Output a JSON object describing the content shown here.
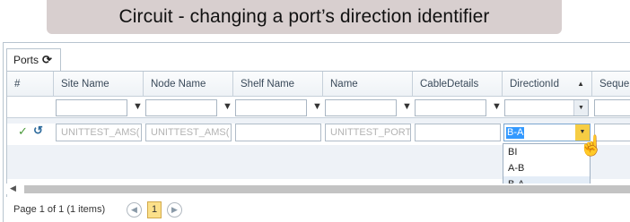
{
  "caption": "Circuit - changing a port’s direction identifier",
  "tab": {
    "label": "Ports",
    "refresh_icon": "refresh-icon"
  },
  "columns": [
    {
      "label": "#"
    },
    {
      "label": "Site Name"
    },
    {
      "label": "Node Name"
    },
    {
      "label": "Shelf Name"
    },
    {
      "label": "Name"
    },
    {
      "label": "CableDetails"
    },
    {
      "label": "DirectionId",
      "sort": "ascending"
    },
    {
      "label": "Sequen"
    }
  ],
  "row": {
    "icons": [
      "check-icon",
      "undo-icon"
    ],
    "site_name": "UNITTEST_AMS(",
    "node_name": "UNITTEST_AMS(",
    "shelf_name": "",
    "name": "UNITTEST_PORT",
    "cable_details": "",
    "direction_id": "B-A"
  },
  "dropdown": {
    "options": [
      "BI",
      "A-B",
      "B-A"
    ],
    "selected": "B-A"
  },
  "pager": {
    "info": "Page 1 of 1 (1 items)",
    "current_page": "1"
  },
  "colors": {
    "caption_bg": "#d8cfcf",
    "header_bg": "#eef2f6",
    "selected_text_bg": "#3399ff",
    "dropdown_arrow_bg": "#f6cd44"
  }
}
